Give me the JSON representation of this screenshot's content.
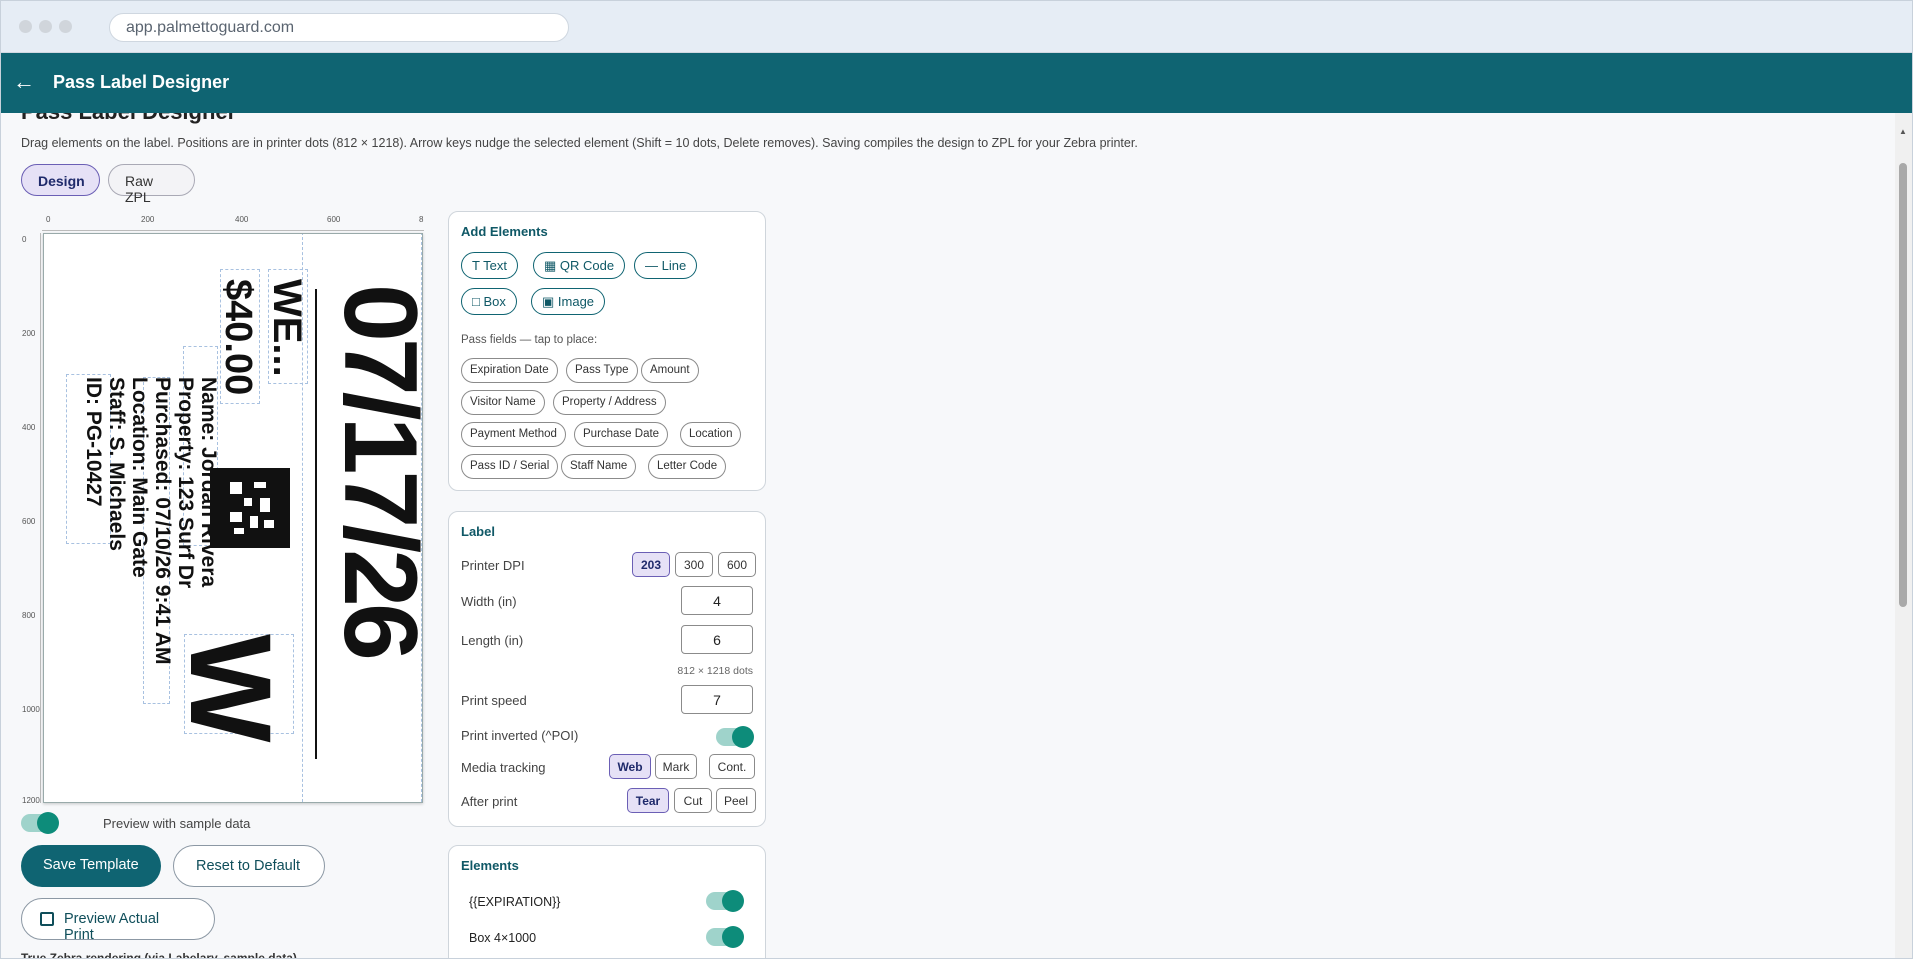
{
  "browser": {
    "url": "app.palmettoguard.com"
  },
  "appbar": {
    "title": "Pass Label Designer"
  },
  "intro": {
    "description": "Drag elements on the label. Positions are in printer dots (812 × 1218). Arrow keys nudge the selected element (Shift = 10 dots, Delete removes). Saving compiles the design to ZPL for your Zebra printer."
  },
  "tabs": [
    {
      "label": "Design"
    },
    {
      "label": "Raw ZPL"
    }
  ],
  "ruler": {
    "top": [
      "0",
      "200",
      "400",
      "600",
      "8"
    ],
    "left": [
      "0",
      "200",
      "400",
      "600",
      "800",
      "1000",
      "1200"
    ]
  },
  "label_preview": {
    "date": "07/17/26",
    "we": "WE...",
    "amount": "$40.00",
    "letter": "W",
    "info": [
      "Name: Jordan Rivera",
      "Property: 123 Surf Dr",
      "Purchased: 07/10/26 9:41 AM",
      "Location: Main Gate",
      "Staff: S. Michaels",
      "ID: PG-10427"
    ]
  },
  "preview_toggle": {
    "label": "Preview with sample data",
    "on": true
  },
  "actions": {
    "save": "Save Template",
    "reset": "Reset to Default",
    "preview_print": "Preview Actual Print",
    "note": "True Zebra rendering (via Labelary, sample data)"
  },
  "add_elements": {
    "title": "Add Elements",
    "tools": [
      {
        "label": "Text",
        "icon": "text-icon"
      },
      {
        "label": "QR Code",
        "icon": "qr-icon"
      },
      {
        "label": "Line",
        "icon": "line-icon"
      },
      {
        "label": "Box",
        "icon": "box-icon"
      },
      {
        "label": "Image",
        "icon": "image-icon"
      }
    ],
    "fields_hint": "Pass fields — tap to place:",
    "fields": [
      "Expiration Date",
      "Pass Type",
      "Amount",
      "Visitor Name",
      "Property / Address",
      "Payment Method",
      "Purchase Date",
      "Location",
      "Pass ID / Serial",
      "Staff Name",
      "Letter Code"
    ]
  },
  "label_settings": {
    "title": "Label",
    "dpi_label": "Printer DPI",
    "dpi_options": [
      "203",
      "300",
      "600"
    ],
    "dpi_selected": "203",
    "width_label": "Width (in)",
    "width": "4",
    "length_label": "Length (in)",
    "length": "6",
    "dots": "812 × 1218 dots",
    "speed_label": "Print speed",
    "speed": "7",
    "inverted_label": "Print inverted (^POI)",
    "inverted_on": true,
    "tracking_label": "Media tracking",
    "tracking_options": [
      "Web",
      "Mark",
      "Cont."
    ],
    "tracking_selected": "Web",
    "after_label": "After print",
    "after_options": [
      "Tear",
      "Cut",
      "Peel"
    ],
    "after_selected": "Tear"
  },
  "elements_panel": {
    "title": "Elements",
    "items": [
      {
        "label": "{{EXPIRATION}}",
        "on": true
      },
      {
        "label": "Box 4×1000",
        "on": true
      }
    ]
  },
  "colors": {
    "brand": "#0f6472",
    "accent": "#0d8c7a",
    "selected": "#e6e1f6"
  }
}
